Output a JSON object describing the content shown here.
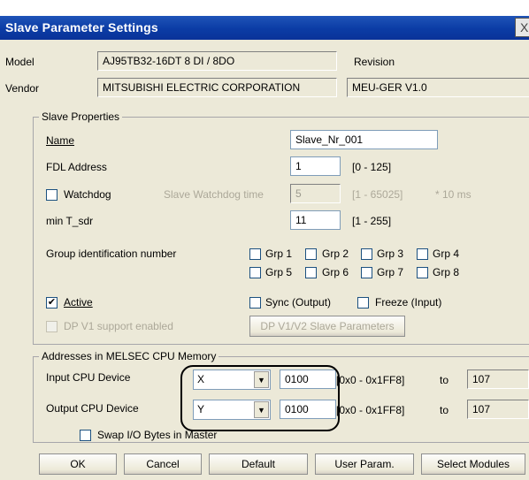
{
  "window": {
    "title": "Slave Parameter Settings",
    "close_glyph": "X"
  },
  "model": {
    "label": "Model",
    "value": "AJ95TB32-16DT  8 DI / 8DO"
  },
  "revision": {
    "label": "Revision",
    "value": ""
  },
  "vendor": {
    "label": "Vendor",
    "value": "MITSUBISHI ELECTRIC CORPORATION",
    "revision_value": "MEU-GER V1.0"
  },
  "slave_properties": {
    "group_label": "Slave Properties",
    "name_label": "Name",
    "name_value": "Slave_Nr_001",
    "fdl_label": "FDL Address",
    "fdl_value": "1",
    "fdl_range": "[0 - 125]",
    "watchdog_label": "Watchdog",
    "watchdog_checked": false,
    "watchdog_time_label": "Slave Watchdog time",
    "watchdog_time_value": "5",
    "watchdog_time_range": "[1 - 65025]",
    "watchdog_time_unit": "* 10 ms",
    "min_tsdr_label": "min T_sdr",
    "min_tsdr_value": "11",
    "min_tsdr_range": "[1 - 255]",
    "group_id_label": "Group identification number",
    "groups": [
      "Grp 1",
      "Grp 2",
      "Grp 3",
      "Grp 4",
      "Grp 5",
      "Grp 6",
      "Grp 7",
      "Grp 8"
    ],
    "active_label": "Active",
    "active_checked": true,
    "sync_label": "Sync (Output)",
    "freeze_label": "Freeze (Input)",
    "dpv1_label": "DP V1 support enabled",
    "dpv1_button": "DP V1/V2 Slave Parameters"
  },
  "addresses": {
    "group_label": "Addresses in MELSEC CPU Memory",
    "input_label": "Input CPU Device",
    "input_device": "X",
    "input_start": "0100",
    "input_range": "[0x0 - 0x1FF8]",
    "input_to_label": "to",
    "input_end": "107",
    "output_label": "Output CPU Device",
    "output_device": "Y",
    "output_start": "0100",
    "output_range": "[0x0 - 0x1FF8]",
    "output_to_label": "to",
    "output_end": "107",
    "swap_label": "Swap I/O Bytes in Master",
    "swap_checked": false
  },
  "buttons": {
    "ok": "OK",
    "cancel": "Cancel",
    "default": "Default",
    "user_param": "User Param.",
    "select_modules": "Select Modules"
  },
  "icons": {
    "check": "✔",
    "dropdown": "▼"
  }
}
